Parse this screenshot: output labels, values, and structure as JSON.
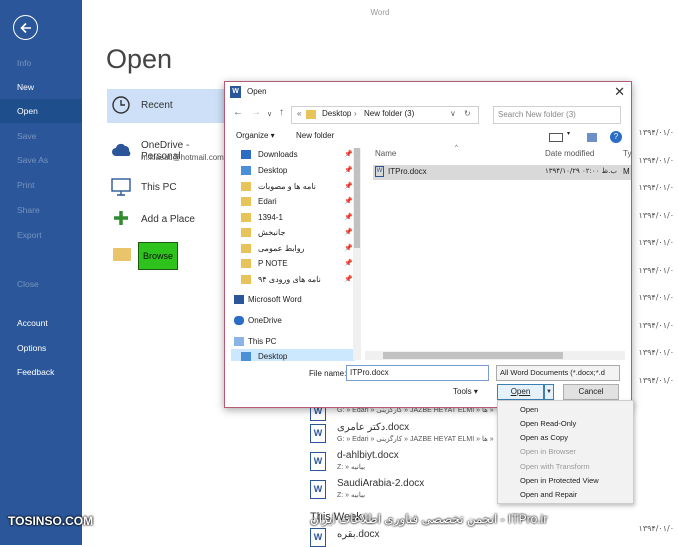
{
  "app": {
    "title": "Word"
  },
  "rail": {
    "items": [
      "Info",
      "New",
      "Open",
      "Save",
      "Save As",
      "Print",
      "Share",
      "Export",
      "Close",
      "Account",
      "Options",
      "Feedback"
    ]
  },
  "main": {
    "heading": "Open",
    "places": [
      {
        "label": "Recent",
        "sub": ""
      },
      {
        "label": "OneDrive - Personal",
        "sub": "m.kiasati@hotmail.com"
      },
      {
        "label": "This PC",
        "sub": ""
      },
      {
        "label": "Add a Place",
        "sub": ""
      }
    ],
    "browse_label": "Browse"
  },
  "right_dates": [
    "۱۳۹۴/۰۱/۰",
    "۱۳۹۴/۰۱/۰",
    "۱۳۹۴/۰۱/۰",
    "۱۳۹۴/۰۱/۰",
    "۱۳۹۴/۰۱/۰",
    "۱۳۹۴/۰۱/۰",
    "۱۳۹۴/۰۱/۰",
    "۱۳۹۴/۰۱/۰",
    "۱۳۹۴/۰۱/۰",
    "۱۳۹۴/۰۱/۰",
    "۱۳۹۴/۰۱/۰"
  ],
  "recent_docs": [
    {
      "title": "",
      "path": "G: » Edari » کارگزینی » JAZBE HEYAT ELMI » ها »"
    },
    {
      "title": "دکتر عامری.docx",
      "path": "G: » Edari » کارگزینی » JAZBE HEYAT ELMI » ها »"
    },
    {
      "title": "d-ahlbiyt.docx",
      "path": "Z: » بیانیه"
    },
    {
      "title": "SaudiArabia-2.docx",
      "path": "Z: » بیانیه"
    },
    {
      "title": "بقره.docx",
      "path": ""
    }
  ],
  "section_this_week": "This Week",
  "watermark": {
    "left": "TOSINSO.COM",
    "mid": "انجمن تخصصی فناوری اطلاعات ایران - ITPro.ir"
  },
  "dialog": {
    "title": "Open",
    "address": {
      "crumb1": "Desktop",
      "crumb2": "New folder (3)"
    },
    "search_placeholder": "Search New folder (3)",
    "organize": "Organize ▾",
    "new_folder": "New folder",
    "tree": [
      {
        "label": "Downloads",
        "pinned": true
      },
      {
        "label": "Desktop",
        "pinned": true
      },
      {
        "label": "نامه ها و مصوبات",
        "pinned": true
      },
      {
        "label": "Edari",
        "pinned": true
      },
      {
        "label": "1394-1",
        "pinned": true
      },
      {
        "label": "جانبخش",
        "pinned": true
      },
      {
        "label": "روابط عمومی",
        "pinned": true
      },
      {
        "label": "P NOTE",
        "pinned": true
      },
      {
        "label": "نامه های ورودی ۹۴",
        "pinned": true
      },
      {
        "label": "Microsoft Word",
        "pinned": false
      },
      {
        "label": "OneDrive",
        "pinned": false
      },
      {
        "label": "This PC",
        "pinned": false
      },
      {
        "label": "Desktop",
        "pinned": false
      }
    ],
    "columns": {
      "name": "Name",
      "date": "Date modified",
      "type": "Ty"
    },
    "file": {
      "name": "ITPro.docx",
      "date": "۱۳۹۴/۱۰/۲۹ ب.ظ ۰۲:۰۰",
      "type": "M"
    },
    "filename_label": "File name:",
    "filename_value": "ITPro.docx",
    "filetype_value": "All Word Documents (*.docx;*.d",
    "tools": "Tools ▾",
    "open_label": "Open",
    "cancel_label": "Cancel",
    "menu": [
      "Open",
      "Open Read-Only",
      "Open as Copy",
      "Open in Browser",
      "Open with Transform",
      "Open in Protected View",
      "Open and Repair"
    ]
  }
}
